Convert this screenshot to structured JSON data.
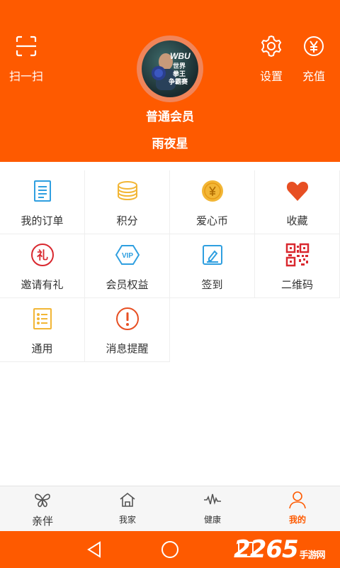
{
  "header": {
    "scan_label": "扫一扫",
    "settings_label": "设置",
    "recharge_label": "充值",
    "member_level": "普通会员",
    "nickname": "雨夜星",
    "avatar_text": [
      "WBU",
      "世界",
      "拳王",
      "争霸赛"
    ]
  },
  "grid": [
    {
      "label": "我的订单",
      "icon": "order-list-icon"
    },
    {
      "label": "积分",
      "icon": "points-coins-icon"
    },
    {
      "label": "爱心币",
      "icon": "love-coin-icon"
    },
    {
      "label": "收藏",
      "icon": "heart-icon"
    },
    {
      "label": "邀请有礼",
      "icon": "gift-invite-icon"
    },
    {
      "label": "会员权益",
      "icon": "vip-icon"
    },
    {
      "label": "签到",
      "icon": "checkin-icon"
    },
    {
      "label": "二维码",
      "icon": "qr-code-icon"
    },
    {
      "label": "通用",
      "icon": "general-list-icon"
    },
    {
      "label": "消息提醒",
      "icon": "alert-icon"
    }
  ],
  "bottom_nav": [
    {
      "label": "亲伴",
      "icon": "butterfly-icon"
    },
    {
      "label": "我家",
      "icon": "home-icon"
    },
    {
      "label": "健康",
      "icon": "pulse-icon"
    },
    {
      "label": "我的",
      "icon": "user-icon",
      "active": true
    }
  ],
  "watermark": {
    "main": "2265",
    "sub": "手游网"
  },
  "colors": {
    "brand_orange": "#fe5a00",
    "icon_blue": "#2f9fe0",
    "icon_gold": "#f2b636",
    "icon_red": "#e74f23",
    "icon_qr_red": "#d9282f",
    "tab_inactive": "#333333"
  }
}
